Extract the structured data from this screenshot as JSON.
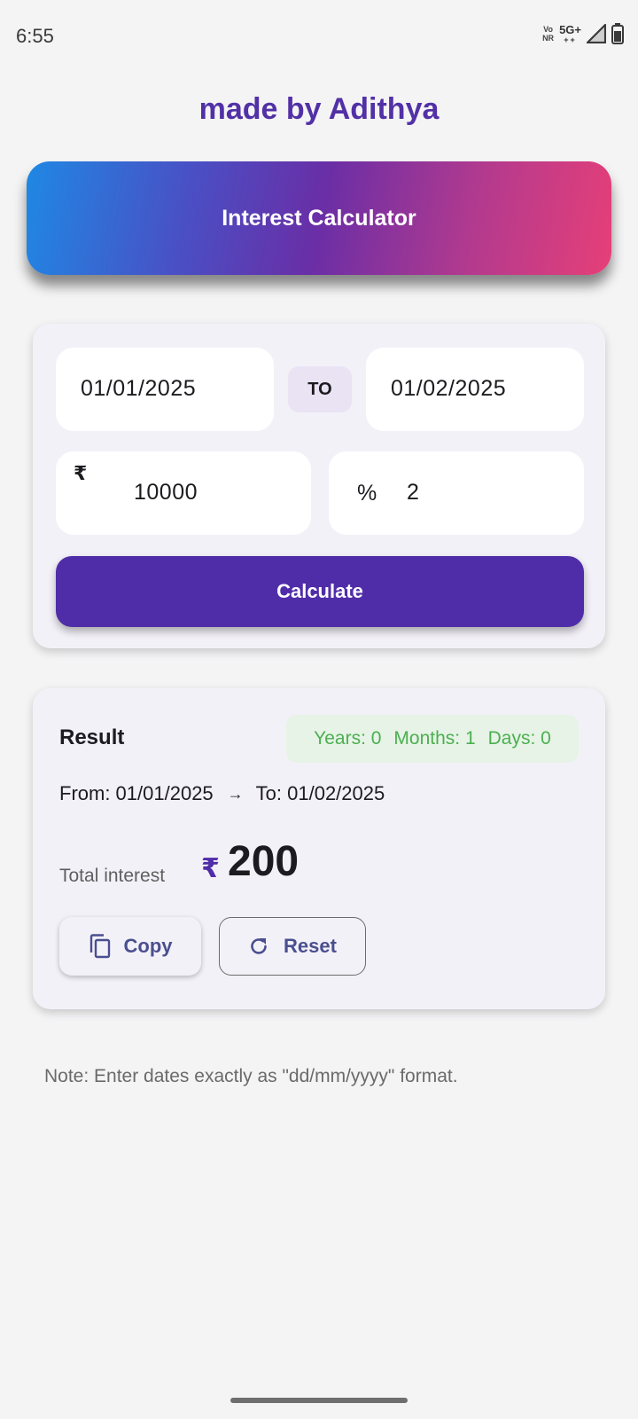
{
  "status_bar": {
    "time": "6:55",
    "volte_top": "Vo",
    "volte_bottom": "NR",
    "network": "5G+",
    "network_sub": "++"
  },
  "header": {
    "made_by": "made by Adithya",
    "title": "Interest Calculator"
  },
  "inputs": {
    "date_from": "01/01/2025",
    "to_label": "TO",
    "date_to": "01/02/2025",
    "currency_symbol": "₹",
    "principal": "10000",
    "percent_symbol": "%",
    "rate": "2",
    "calculate_label": "Calculate"
  },
  "result": {
    "title": "Result",
    "years": "Years: 0",
    "months": "Months: 1",
    "days": "Days: 0",
    "from_text": "From: 01/01/2025",
    "arrow": "→",
    "to_text": "To: 01/02/2025",
    "total_label": "Total interest",
    "currency_symbol": "₹",
    "total_value": "200",
    "copy_label": "Copy",
    "reset_label": "Reset"
  },
  "note": "Note: Enter dates exactly as \"dd/mm/yyyy\" format.",
  "colors": {
    "primary": "#502da8",
    "gradient_start": "#1f88e4",
    "gradient_end": "#e63f78",
    "duration_text": "#4caf50",
    "card_bg": "#f3f1f8"
  }
}
